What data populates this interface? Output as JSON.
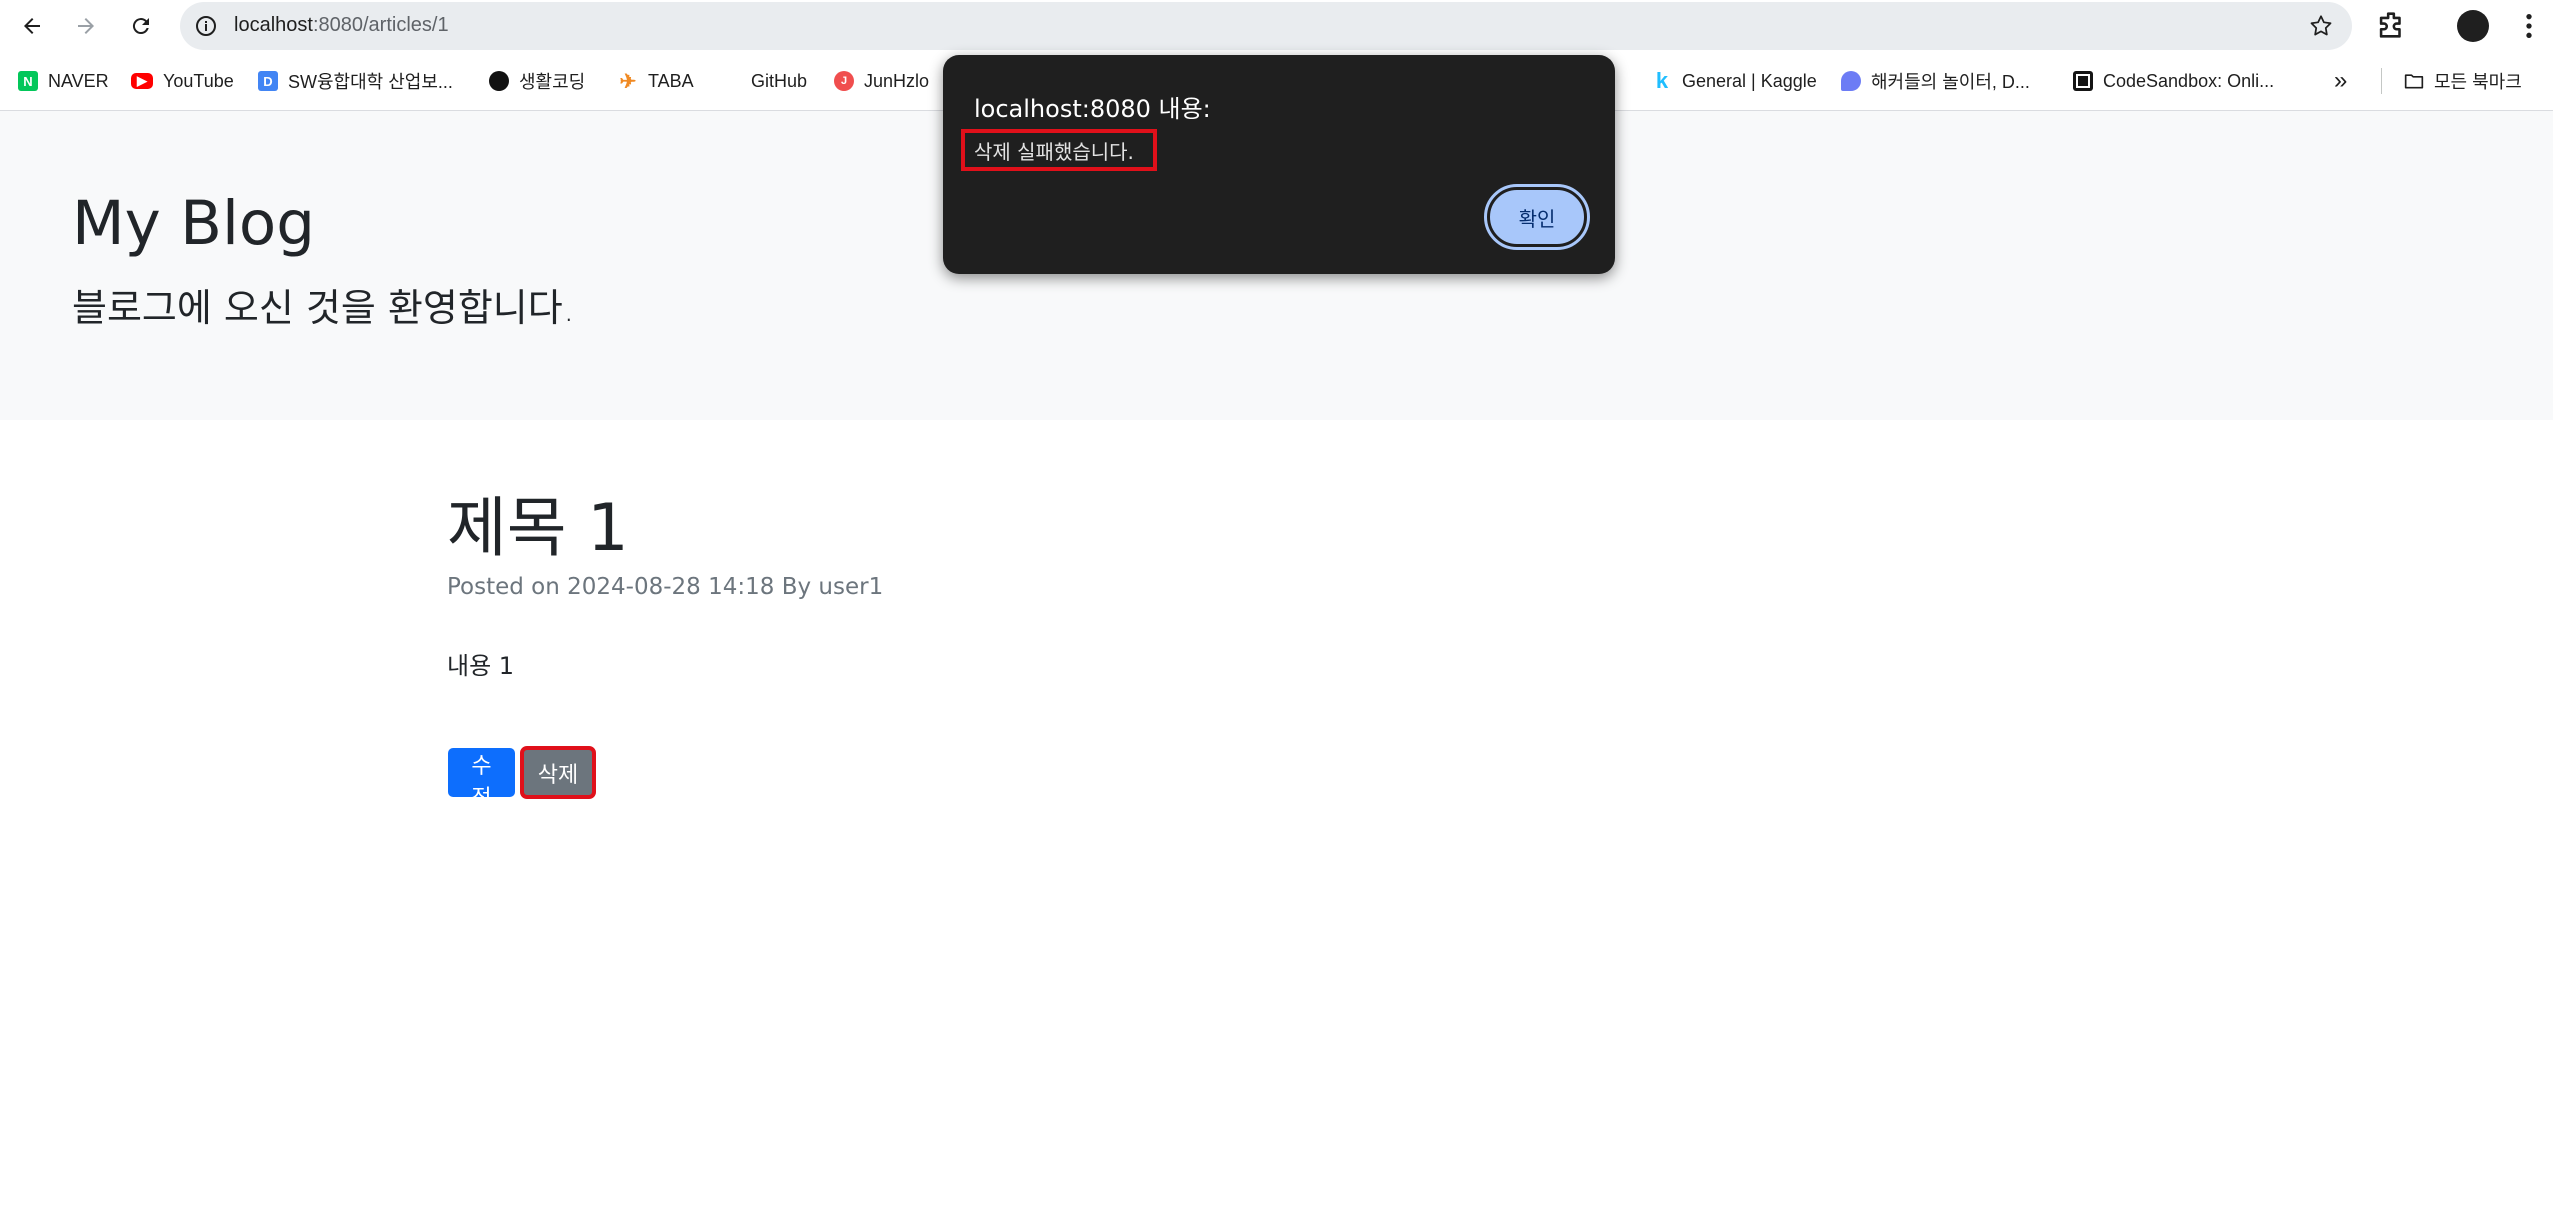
{
  "browser": {
    "url_host": "localhost",
    "url_path": ":8080/articles/1",
    "bookmarks": [
      {
        "label": "NAVER",
        "icon": "naver-icon",
        "color": "#03c75a"
      },
      {
        "label": "YouTube",
        "icon": "youtube-icon",
        "color": "#ff0000"
      },
      {
        "label": "SW융합대학 산업보...",
        "icon": "d-icon",
        "color": "#4285f4"
      },
      {
        "label": "생활코딩",
        "icon": "dot-icon",
        "color": "#111111"
      },
      {
        "label": "TABA",
        "icon": "airplane-icon",
        "color": "#f08a24"
      },
      {
        "label": "GitHub",
        "icon": "github-icon",
        "color": "#ffffff"
      },
      {
        "label": "JunHzlo",
        "icon": "junhzlo-icon",
        "color": "#f04e4e"
      },
      {
        "label": "General | Kaggle",
        "icon": "kaggle-icon",
        "color": "#20beff"
      },
      {
        "label": "해커들의 놀이터, D...",
        "icon": "dreamhack-icon",
        "color": "#6c7cf5"
      },
      {
        "label": "CodeSandbox: Onli...",
        "icon": "codesandbox-icon",
        "color": "#151515"
      }
    ],
    "more_bookmarks_label": "»",
    "all_bookmarks_label": "모든 북마크"
  },
  "header": {
    "title": "My Blog",
    "subtitle": "블로그에 오신 것을 환영합니다."
  },
  "article": {
    "title": "제목 1",
    "meta": "Posted on 2024-08-28 14:18 By user1",
    "content": "내용 1",
    "edit_label": "수정",
    "delete_label": "삭제"
  },
  "dialog": {
    "title": "localhost:8080 내용:",
    "message": "삭제 실패했습니다.",
    "ok_label": "확인"
  },
  "colors": {
    "primary": "#0d6efd",
    "secondary": "#6c757d",
    "highlight": "#e0101a",
    "dialog_bg": "#1f1f1f",
    "dialog_button": "#a8c7fa"
  }
}
